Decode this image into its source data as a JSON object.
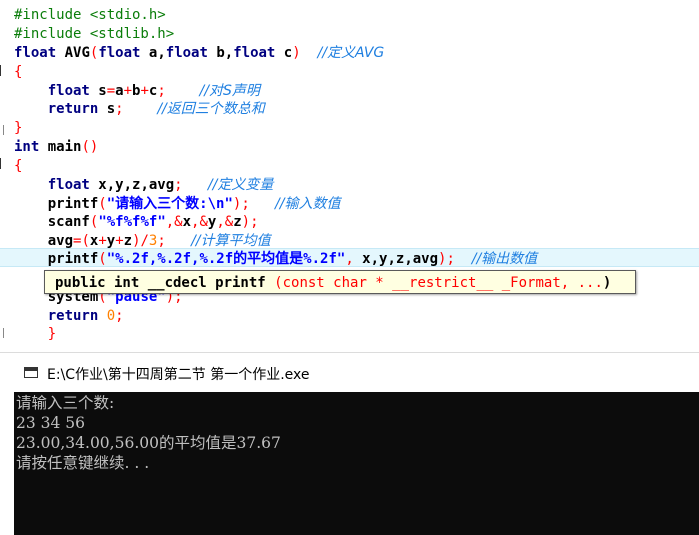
{
  "editor": {
    "lines": [
      {
        "id": "l1",
        "parts": [
          {
            "t": "#include <stdio.h>",
            "c": "pp"
          }
        ]
      },
      {
        "id": "l2",
        "parts": [
          {
            "t": "#include <stdlib.h>",
            "c": "pp"
          }
        ]
      },
      {
        "id": "l3",
        "parts": [
          {
            "t": "float",
            "c": "kw"
          },
          {
            "t": " AVG",
            "c": "bold"
          },
          {
            "t": "(",
            "c": "op"
          },
          {
            "t": "float",
            "c": "kw"
          },
          {
            "t": " a,",
            "c": "bold"
          },
          {
            "t": "float",
            "c": "kw"
          },
          {
            "t": " b,",
            "c": "bold"
          },
          {
            "t": "float",
            "c": "kw"
          },
          {
            "t": " c",
            "c": "bold"
          },
          {
            "t": ")",
            "c": "op"
          },
          {
            "t": "  ",
            "c": ""
          },
          {
            "t": "//定义AVG",
            "c": "cm"
          }
        ]
      },
      {
        "id": "l4",
        "parts": [
          {
            "t": "{",
            "c": "op"
          }
        ]
      },
      {
        "id": "l5",
        "parts": [
          {
            "t": "    ",
            "c": ""
          },
          {
            "t": "float",
            "c": "kw"
          },
          {
            "t": " s",
            "c": "bold"
          },
          {
            "t": "=",
            "c": "op"
          },
          {
            "t": "a",
            "c": "bold"
          },
          {
            "t": "+",
            "c": "op"
          },
          {
            "t": "b",
            "c": "bold"
          },
          {
            "t": "+",
            "c": "op"
          },
          {
            "t": "c",
            "c": "bold"
          },
          {
            "t": ";",
            "c": "op"
          },
          {
            "t": "    ",
            "c": ""
          },
          {
            "t": "//对S声明",
            "c": "cm"
          }
        ]
      },
      {
        "id": "l6",
        "parts": [
          {
            "t": "    ",
            "c": ""
          },
          {
            "t": "return",
            "c": "kw"
          },
          {
            "t": " s",
            "c": "bold"
          },
          {
            "t": ";",
            "c": "op"
          },
          {
            "t": "    ",
            "c": ""
          },
          {
            "t": "//返回三个数总和",
            "c": "cm"
          }
        ]
      },
      {
        "id": "l7",
        "parts": [
          {
            "t": "}",
            "c": "op"
          }
        ]
      },
      {
        "id": "l8",
        "parts": [
          {
            "t": "int",
            "c": "kw"
          },
          {
            "t": " main",
            "c": "bold"
          },
          {
            "t": "()",
            "c": "op"
          }
        ]
      },
      {
        "id": "l9",
        "parts": [
          {
            "t": "{",
            "c": "op"
          }
        ]
      },
      {
        "id": "l10",
        "parts": [
          {
            "t": "    ",
            "c": ""
          },
          {
            "t": "float",
            "c": "kw"
          },
          {
            "t": " x,y,z,avg",
            "c": "bold"
          },
          {
            "t": ";",
            "c": "op"
          },
          {
            "t": "   ",
            "c": ""
          },
          {
            "t": "//定义变量",
            "c": "cm"
          }
        ]
      },
      {
        "id": "l11",
        "parts": [
          {
            "t": "    ",
            "c": ""
          },
          {
            "t": "printf",
            "c": "bold"
          },
          {
            "t": "(",
            "c": "op"
          },
          {
            "t": "\"请输入三个数:\\n\"",
            "c": "str"
          },
          {
            "t": ");",
            "c": "op"
          },
          {
            "t": "   ",
            "c": ""
          },
          {
            "t": "//输入数值",
            "c": "cm"
          }
        ]
      },
      {
        "id": "l12",
        "parts": [
          {
            "t": "    ",
            "c": ""
          },
          {
            "t": "scanf",
            "c": "bold"
          },
          {
            "t": "(",
            "c": "op"
          },
          {
            "t": "\"%f%f%f\"",
            "c": "str"
          },
          {
            "t": ",&",
            "c": "op"
          },
          {
            "t": "x",
            "c": "bold"
          },
          {
            "t": ",&",
            "c": "op"
          },
          {
            "t": "y",
            "c": "bold"
          },
          {
            "t": ",&",
            "c": "op"
          },
          {
            "t": "z",
            "c": "bold"
          },
          {
            "t": ");",
            "c": "op"
          }
        ]
      },
      {
        "id": "l13",
        "parts": [
          {
            "t": "    ",
            "c": ""
          },
          {
            "t": "avg",
            "c": "bold"
          },
          {
            "t": "=(",
            "c": "op"
          },
          {
            "t": "x",
            "c": "bold"
          },
          {
            "t": "+",
            "c": "op"
          },
          {
            "t": "y",
            "c": "bold"
          },
          {
            "t": "+",
            "c": "op"
          },
          {
            "t": "z",
            "c": "bold"
          },
          {
            "t": ")/",
            "c": "op"
          },
          {
            "t": "3",
            "c": "num"
          },
          {
            "t": ";",
            "c": "op"
          },
          {
            "t": "   ",
            "c": ""
          },
          {
            "t": "//计算平均值",
            "c": "cm"
          }
        ]
      },
      {
        "id": "l14",
        "parts": [
          {
            "t": "    ",
            "c": ""
          },
          {
            "t": "printf",
            "c": "bold"
          },
          {
            "t": "(",
            "c": "op"
          },
          {
            "t": "\"%.2f,%.2f,%.2f的平均值是%.2f\"",
            "c": "str"
          },
          {
            "t": ", ",
            "c": "op"
          },
          {
            "t": "x,y,z,avg",
            "c": "bold"
          },
          {
            "t": ");",
            "c": "op"
          },
          {
            "t": "  ",
            "c": ""
          },
          {
            "t": "//输出数值",
            "c": "cm"
          }
        ]
      },
      {
        "id": "l15",
        "parts": [
          {
            "t": "    ",
            "c": ""
          },
          {
            "t": "system",
            "c": "bold"
          },
          {
            "t": "(",
            "c": "op"
          },
          {
            "t": "\"pause\"",
            "c": "str"
          },
          {
            "t": ");",
            "c": "op"
          }
        ]
      },
      {
        "id": "l16",
        "parts": [
          {
            "t": "    ",
            "c": ""
          },
          {
            "t": "return",
            "c": "kw"
          },
          {
            "t": " ",
            "c": ""
          },
          {
            "t": "0",
            "c": "num"
          },
          {
            "t": ";",
            "c": "op"
          }
        ]
      },
      {
        "id": "l17",
        "parts": [
          {
            "t": "    ",
            "c": ""
          },
          {
            "t": "}",
            "c": "op"
          }
        ]
      }
    ],
    "tooltip": {
      "parts": [
        {
          "t": "public int __cdecl printf ",
          "c": "tk"
        },
        {
          "t": "(",
          "c": "tt"
        },
        {
          "t": "const char * __restrict__ _Format, ...",
          "c": "tt"
        },
        {
          "t": ")",
          "c": "tk"
        }
      ]
    }
  },
  "console": {
    "title": "E:\\C作业\\第十四周第二节 第一个作业.exe",
    "output": [
      "请输入三个数:",
      "23 34 56",
      "23.00,34.00,56.00的平均值是37.67",
      "请按任意键继续. . ."
    ]
  }
}
